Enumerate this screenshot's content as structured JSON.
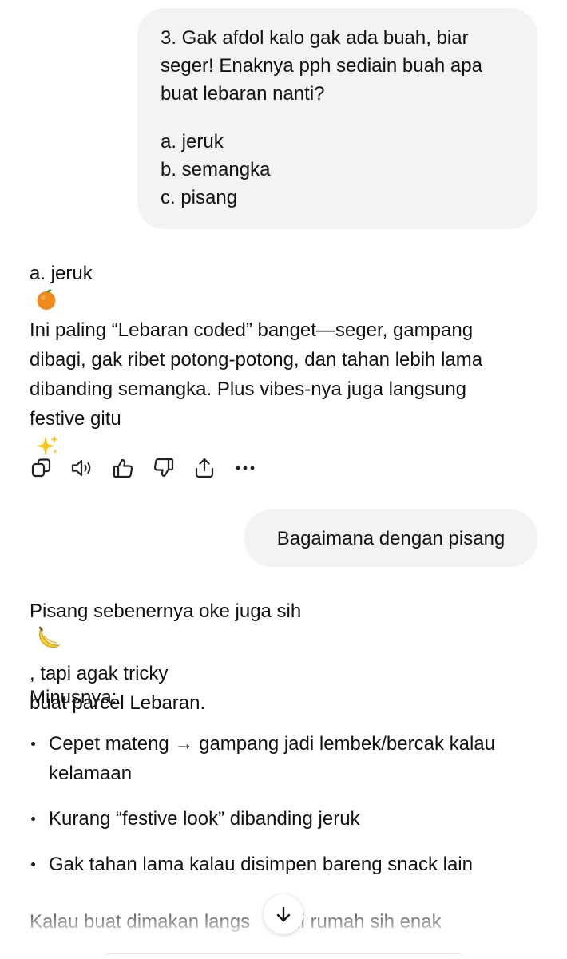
{
  "user_message_1": {
    "question": [
      "3. Gak afdol kalo gak ada buah, biar",
      "seger! Enaknya pph sediain buah apa",
      "buat lebaran nanti?"
    ],
    "options": [
      "a. jeruk",
      "b. semangka",
      "c. pisang"
    ]
  },
  "assistant_message_1": {
    "answer": "a. jeruk",
    "answer_emoji": "orange-emoji",
    "body_lines": [
      "Ini paling “Lebaran coded” banget—seger, gampang",
      "dibagi, gak ribet potong-potong, dan tahan lebih lama",
      "dibanding semangka. Plus vibes-nya juga langsung",
      "festive gitu"
    ],
    "body_emoji": "sparkles-emoji"
  },
  "message_actions": [
    "copy-icon",
    "read-aloud-icon",
    "thumbs-up-icon",
    "thumbs-down-icon",
    "share-icon",
    "more-icon"
  ],
  "user_message_2": {
    "text": "Bagaimana dengan pisang"
  },
  "assistant_message_2": {
    "intro_line_1": "Pisang sebenernya oke juga sih",
    "intro_line_1_after": ", tapi agak tricky",
    "intro_line_2": "buat parcel Lebaran.",
    "intro_emoji": "banana-emoji",
    "minus_heading": "Minusnya:",
    "bullets": [
      [
        "Cepet mateng → gampang jadi lembek/bercak kalau",
        "kelamaan"
      ],
      [
        "Kurang “festive look” dibanding jeruk"
      ],
      [
        "Gak tahan lama kalau disimpen bareng snack lain"
      ]
    ],
    "cutoff_line_left": "Kalau buat dimakan langs",
    "cutoff_line_right": "di rumah sih enak"
  },
  "scroll_button": {
    "icon": "arrow-down-icon"
  }
}
